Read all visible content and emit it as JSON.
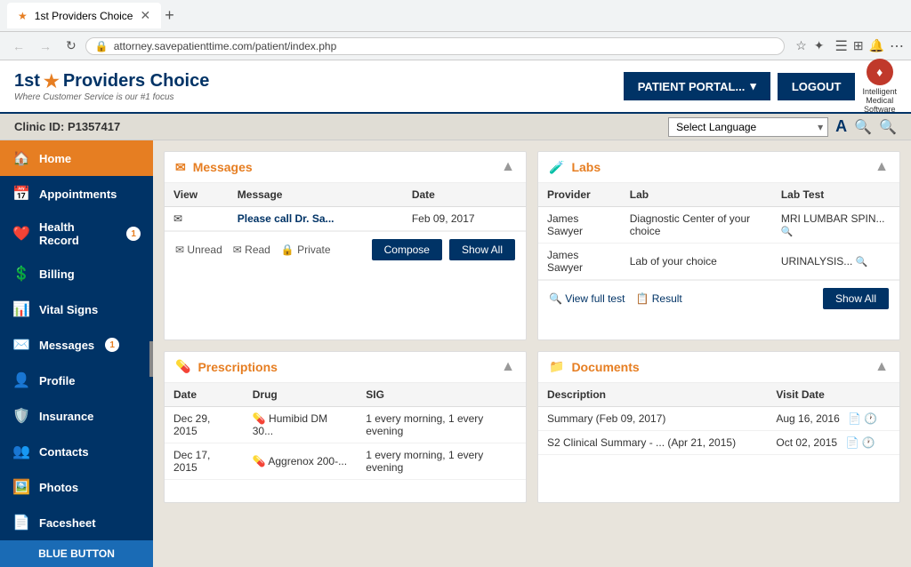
{
  "browser": {
    "tab_title": "1st Providers Choice",
    "url": "attorney.savepatienttime.com/patient/index.php"
  },
  "header": {
    "logo_prefix": "1st",
    "logo_star": "★",
    "logo_suffix": "Providers Choice",
    "logo_subtitle": "Where Customer Service is our #1 focus",
    "patient_portal_label": "PATIENT PORTAL...",
    "logout_label": "LOGOUT",
    "ims_line1": "Intelligent",
    "ims_line2": "Medical",
    "ims_line3": "Software"
  },
  "clinic_bar": {
    "clinic_id": "Clinic ID: P1357417",
    "lang_placeholder": "Select Language",
    "toolbar_a": "A",
    "toolbar_search1": "🔍",
    "toolbar_search2": "🔍"
  },
  "sidebar": {
    "items": [
      {
        "id": "home",
        "icon": "🏠",
        "label": "Home",
        "active": true,
        "badge": null
      },
      {
        "id": "appointments",
        "icon": "📅",
        "label": "Appointments",
        "active": false,
        "badge": null
      },
      {
        "id": "health-record",
        "icon": "❤️",
        "label": "Health Record",
        "active": false,
        "badge": "1"
      },
      {
        "id": "billing",
        "icon": "💲",
        "label": "Billing",
        "active": false,
        "badge": null
      },
      {
        "id": "vital-signs",
        "icon": "📊",
        "label": "Vital Signs",
        "active": false,
        "badge": null
      },
      {
        "id": "messages",
        "icon": "✉️",
        "label": "Messages",
        "active": false,
        "badge": "1"
      },
      {
        "id": "profile",
        "icon": "👤",
        "label": "Profile",
        "active": false,
        "badge": null
      },
      {
        "id": "insurance",
        "icon": "🛡️",
        "label": "Insurance",
        "active": false,
        "badge": null
      },
      {
        "id": "contacts",
        "icon": "👥",
        "label": "Contacts",
        "active": false,
        "badge": null
      },
      {
        "id": "photos",
        "icon": "🖼️",
        "label": "Photos",
        "active": false,
        "badge": null
      },
      {
        "id": "facesheet",
        "icon": "📄",
        "label": "Facesheet",
        "active": false,
        "badge": null
      }
    ],
    "blue_button_label": "BLUE BUTTON"
  },
  "messages_card": {
    "title": "Messages",
    "icon": "✉",
    "columns": [
      "View",
      "Message",
      "Date"
    ],
    "rows": [
      {
        "view_icon": "✉",
        "message": "Please call Dr. Sa...",
        "date": "Feb 09, 2017"
      }
    ],
    "footer": {
      "unread": "Unread",
      "read": "Read",
      "private": "Private",
      "compose_label": "Compose",
      "show_all_label": "Show All"
    }
  },
  "labs_card": {
    "title": "Labs",
    "icon": "🧪",
    "columns": [
      "Provider",
      "Lab",
      "Lab Test"
    ],
    "rows": [
      {
        "provider": "James Sawyer",
        "lab": "Diagnostic Center of your choice",
        "lab_test": "MRI LUMBAR SPIN..."
      },
      {
        "provider": "James Sawyer",
        "lab": "Lab of your choice",
        "lab_test": "URINALYSIS..."
      }
    ],
    "footer": {
      "view_full_label": "View full test",
      "result_label": "Result",
      "show_all_label": "Show All"
    }
  },
  "prescriptions_card": {
    "title": "Prescriptions",
    "icon": "💊",
    "columns": [
      "Date",
      "Drug",
      "SIG"
    ],
    "rows": [
      {
        "date": "Dec 29, 2015",
        "drug": "Humibid DM 30...",
        "sig": "1 every morning, 1 every evening"
      },
      {
        "date": "Dec 17, 2015",
        "drug": "Aggrenox 200-...",
        "sig": "1 every morning, 1 every evening"
      }
    ]
  },
  "documents_card": {
    "title": "Documents",
    "icon": "📁",
    "columns": [
      "Description",
      "Visit Date"
    ],
    "rows": [
      {
        "description": "Summary (Feb 09, 2017)",
        "visit_date": "Aug 16, 2016"
      },
      {
        "description": "S2 Clinical Summary - ... (Apr 21, 2015)",
        "visit_date": "Oct 02, 2015"
      }
    ]
  }
}
